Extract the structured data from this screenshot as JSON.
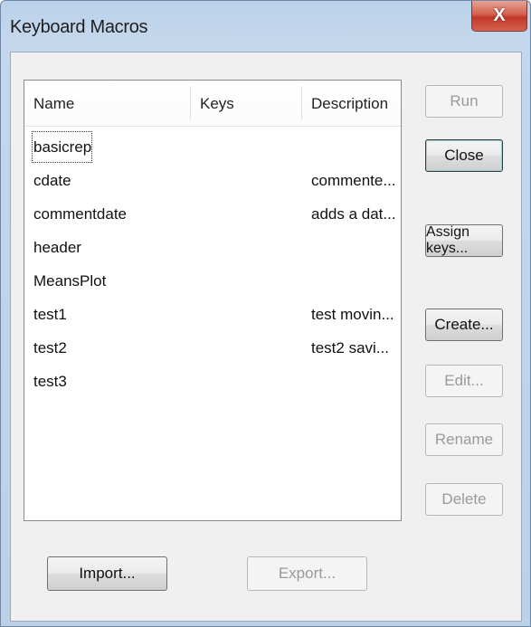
{
  "window": {
    "title": "Keyboard Macros",
    "close_glyph": "X"
  },
  "list": {
    "columns": [
      "Name",
      "Keys",
      "Description"
    ],
    "rows": [
      {
        "name": "basicrep",
        "keys": "",
        "description": ""
      },
      {
        "name": "cdate",
        "keys": "",
        "description": "commente..."
      },
      {
        "name": "commentdate",
        "keys": "",
        "description": "adds a dat..."
      },
      {
        "name": "header",
        "keys": "",
        "description": ""
      },
      {
        "name": "MeansPlot",
        "keys": "",
        "description": ""
      },
      {
        "name": "test1",
        "keys": "",
        "description": "test movin..."
      },
      {
        "name": "test2",
        "keys": "",
        "description": "test2 savi..."
      },
      {
        "name": "test3",
        "keys": "",
        "description": ""
      }
    ]
  },
  "buttons": {
    "run": "Run",
    "close": "Close",
    "assign_keys": "Assign keys...",
    "create": "Create...",
    "edit": "Edit...",
    "rename": "Rename",
    "delete": "Delete",
    "import": "Import...",
    "export": "Export..."
  }
}
